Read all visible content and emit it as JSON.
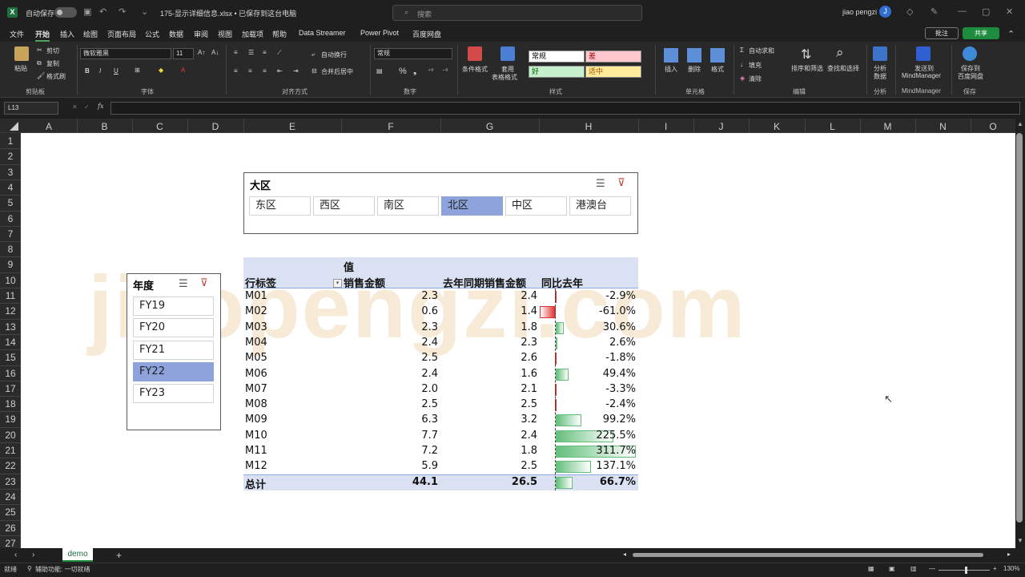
{
  "titlebar": {
    "autosave_label": "自动保存",
    "doc_title": "175-显示详细信息.xlsx • 已保存到这台电脑",
    "search_placeholder": "搜索",
    "user_name": "jiao pengzi",
    "user_initial": "J"
  },
  "menu": {
    "tabs": [
      "文件",
      "开始",
      "插入",
      "绘图",
      "页面布局",
      "公式",
      "数据",
      "审阅",
      "视图",
      "加载项",
      "帮助",
      "Data Streamer",
      "Power Pivot",
      "百度网盘"
    ],
    "active": "开始",
    "comment_label": "批注",
    "share_label": "共享"
  },
  "ribbon": {
    "paste": "粘贴",
    "cut": "剪切",
    "copy": "复制",
    "format_painter": "格式刷",
    "clipboard": "剪贴板",
    "font_name": "微软雅黑",
    "font_size": "11",
    "font_group": "字体",
    "wrap": "自动换行",
    "merge": "合并后居中",
    "align_group": "对齐方式",
    "number_format": "常规",
    "number_group": "数字",
    "cond_format": "条件格式",
    "table_format_1": "套用",
    "table_format_2": "表格格式",
    "style_normal": "常规",
    "style_bad": "差",
    "style_good": "好",
    "style_neutral": "适中",
    "style_group": "样式",
    "insert": "插入",
    "delete": "删除",
    "format": "格式",
    "cells_group": "单元格",
    "autosum": "自动求和",
    "fill": "填充",
    "clear": "清除",
    "sort_filter": "排序和筛选",
    "find_select": "查找和选择",
    "edit_group": "编辑",
    "analyze_1": "分析",
    "analyze_2": "数据",
    "analyze_group": "分析",
    "mm_1": "发送到",
    "mm_2": "MindManager",
    "mm_group": "MindManager",
    "save_1": "保存到",
    "save_2": "百度网盘",
    "save_group": "保存"
  },
  "formula_bar": {
    "name_box": "L13",
    "fx": "fx",
    "formula": ""
  },
  "columns": [
    "A",
    "B",
    "C",
    "D",
    "E",
    "F",
    "G",
    "H",
    "I",
    "J",
    "K",
    "L",
    "M",
    "N",
    "O"
  ],
  "rows": [
    "1",
    "2",
    "3",
    "4",
    "5",
    "6",
    "7",
    "8",
    "9",
    "10",
    "11",
    "12",
    "13",
    "14",
    "15",
    "16",
    "17",
    "18",
    "19",
    "20",
    "21",
    "22",
    "23",
    "24",
    "25",
    "26",
    "27"
  ],
  "watermark": "jiaopengzi.com",
  "region_slicer": {
    "title": "大区",
    "items": [
      "东区",
      "西区",
      "南区",
      "北区",
      "中区",
      "港澳台"
    ],
    "selected": "北区"
  },
  "year_slicer": {
    "title": "年度",
    "items": [
      "FY19",
      "FY20",
      "FY21",
      "FY22",
      "FY23"
    ],
    "selected": "FY22"
  },
  "pivot": {
    "values_label": "值",
    "row_label": "行标签",
    "col_sales": "销售金额",
    "col_last_year": "去年同期销售金额",
    "col_yoy": "同比去年",
    "rows": [
      {
        "label": "M01",
        "sales": "2.3",
        "last": "2.4",
        "yoy": "-2.9%",
        "yoy_value": -2.9
      },
      {
        "label": "M02",
        "sales": "0.6",
        "last": "1.4",
        "yoy": "-61.0%",
        "yoy_value": -61.0
      },
      {
        "label": "M03",
        "sales": "2.3",
        "last": "1.8",
        "yoy": "30.6%",
        "yoy_value": 30.6
      },
      {
        "label": "M04",
        "sales": "2.4",
        "last": "2.3",
        "yoy": "2.6%",
        "yoy_value": 2.6
      },
      {
        "label": "M05",
        "sales": "2.5",
        "last": "2.6",
        "yoy": "-1.8%",
        "yoy_value": -1.8
      },
      {
        "label": "M06",
        "sales": "2.4",
        "last": "1.6",
        "yoy": "49.4%",
        "yoy_value": 49.4
      },
      {
        "label": "M07",
        "sales": "2.0",
        "last": "2.1",
        "yoy": "-3.3%",
        "yoy_value": -3.3
      },
      {
        "label": "M08",
        "sales": "2.5",
        "last": "2.5",
        "yoy": "-2.4%",
        "yoy_value": -2.4
      },
      {
        "label": "M09",
        "sales": "6.3",
        "last": "3.2",
        "yoy": "99.2%",
        "yoy_value": 99.2
      },
      {
        "label": "M10",
        "sales": "7.7",
        "last": "2.4",
        "yoy": "225.5%",
        "yoy_value": 225.5
      },
      {
        "label": "M11",
        "sales": "7.2",
        "last": "1.8",
        "yoy": "311.7%",
        "yoy_value": 311.7
      },
      {
        "label": "M12",
        "sales": "5.9",
        "last": "2.5",
        "yoy": "137.1%",
        "yoy_value": 137.1
      }
    ],
    "total": {
      "label": "总计",
      "sales": "44.1",
      "last": "26.5",
      "yoy": "66.7%",
      "yoy_value": 66.7
    },
    "bar_colors": {
      "positive": "#63be7b",
      "negative": "#e02f2f"
    }
  },
  "sheet_tabs": {
    "active": "demo",
    "add": "+"
  },
  "status": {
    "ready": "就绪",
    "accessibility": "辅助功能: 一切就绪",
    "zoom": "130%"
  }
}
